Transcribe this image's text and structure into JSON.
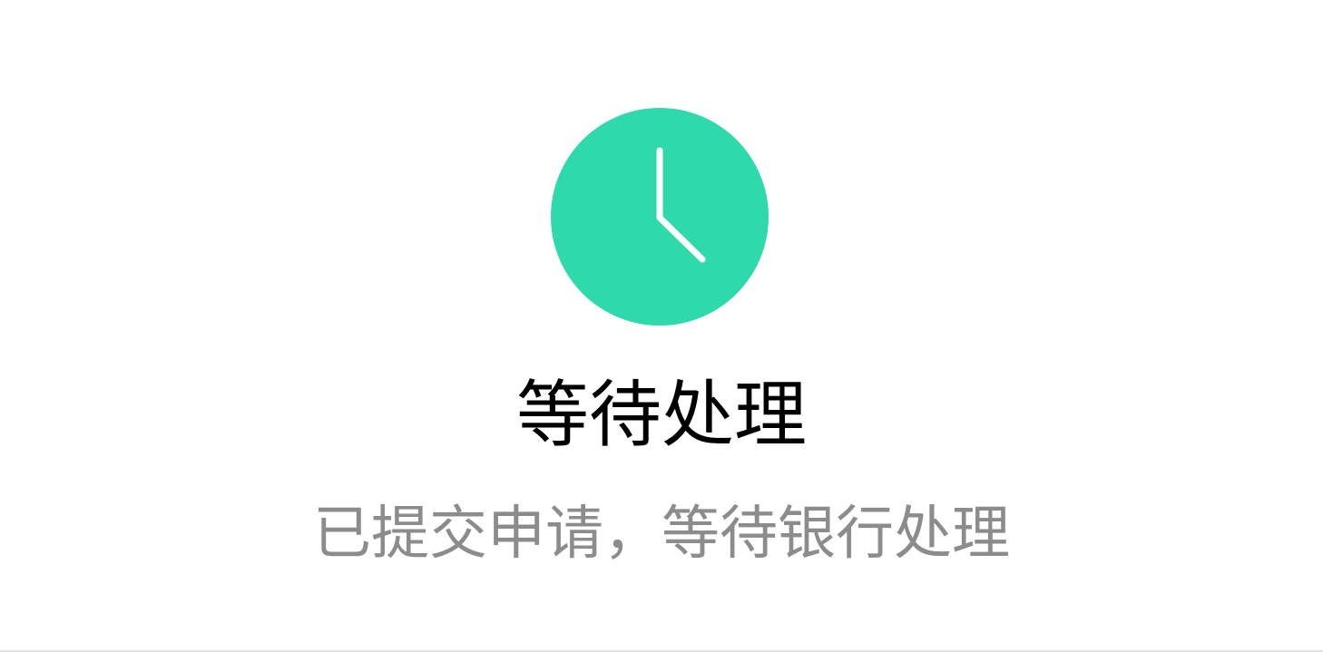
{
  "status": {
    "icon": "clock-icon",
    "icon_color": "#2ED9AB",
    "title": "等待处理",
    "message": "已提交申请，等待银行处理"
  },
  "colors": {
    "title": "#000000",
    "message": "#8C8C8C",
    "background": "#FFFFFF"
  }
}
